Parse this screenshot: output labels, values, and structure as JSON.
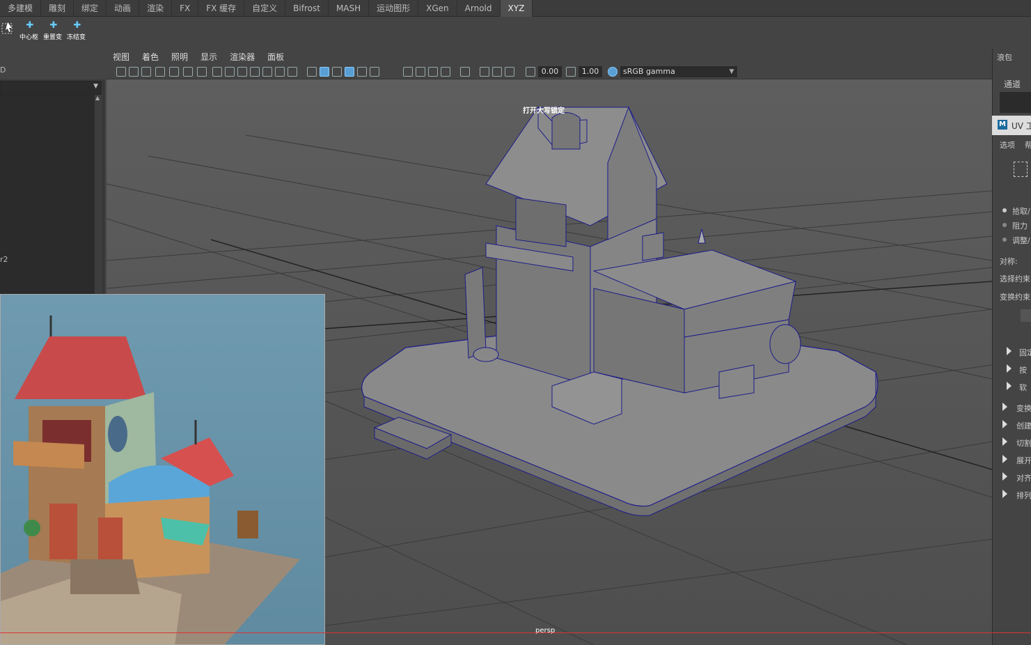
{
  "shelf_tabs": [
    "多建模",
    "雕刻",
    "绑定",
    "动画",
    "渲染",
    "FX",
    "FX 缓存",
    "自定义",
    "Bifrost",
    "MASH",
    "运动图形",
    "XGen",
    "Arnold",
    "XYZ"
  ],
  "shelf_active_tab": "XYZ",
  "shelf_buttons": [
    {
      "label": "中心枢",
      "icon": "pivot-icon"
    },
    {
      "label": "重置变",
      "icon": "reset-transform-icon"
    },
    {
      "label": "冻结变",
      "icon": "freeze-transform-icon"
    }
  ],
  "outliner": {
    "header_text": "D",
    "items": [
      {
        "label": "r2"
      }
    ]
  },
  "viewport": {
    "menu": [
      "视图",
      "着色",
      "照明",
      "显示",
      "渲染器",
      "面板"
    ],
    "exposure_value": "0.00",
    "gamma_value": "1.00",
    "color_space": "sRGB gamma",
    "hud_text": "打开大写锁定",
    "camera_label": "persp"
  },
  "right_panel": {
    "top_label_1": "浪包",
    "channel_label": "通道",
    "uv_title": "UV 工",
    "options_label": "选项",
    "help_label": "帮",
    "radio_items": [
      "拾取/",
      "阻力",
      "调整/"
    ],
    "symmetry_label": "对称:",
    "select_constraint_label": "选择约束",
    "transform_constraint_label": "变换约束",
    "section_items_a": [
      "固定",
      "按",
      "软"
    ],
    "section_items_b": [
      "变换",
      "创建",
      "切割",
      "展开",
      "对齐",
      "排列"
    ]
  }
}
